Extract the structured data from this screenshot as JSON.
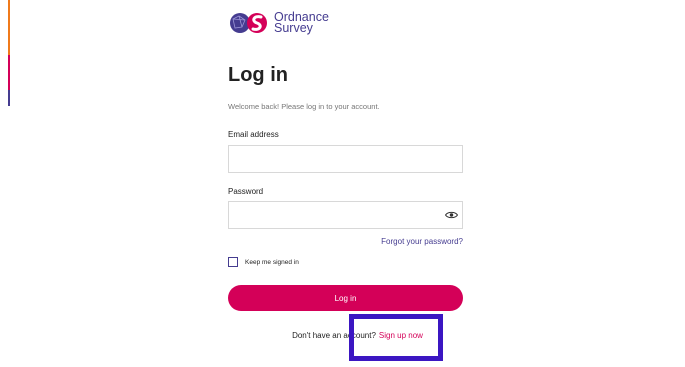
{
  "brand": {
    "name_line1": "Ordnance",
    "name_line2": "Survey",
    "colors": {
      "purple": "#453c90",
      "magenta": "#d40058",
      "orange": "#f07a1b",
      "highlight": "#3b16c2"
    }
  },
  "page": {
    "title": "Log in",
    "subtitle": "Welcome back! Please log in to your account."
  },
  "form": {
    "email_label": "Email address",
    "email_value": "",
    "password_label": "Password",
    "password_value": "",
    "show_password_icon": "eye-icon",
    "forgot_link": "Forgot your password?",
    "keep_signed_in_label": "Keep me signed in",
    "keep_signed_in_checked": false,
    "submit_label": "Log in"
  },
  "signup": {
    "prompt": "Don't have an account?",
    "link_label": "Sign up now"
  }
}
